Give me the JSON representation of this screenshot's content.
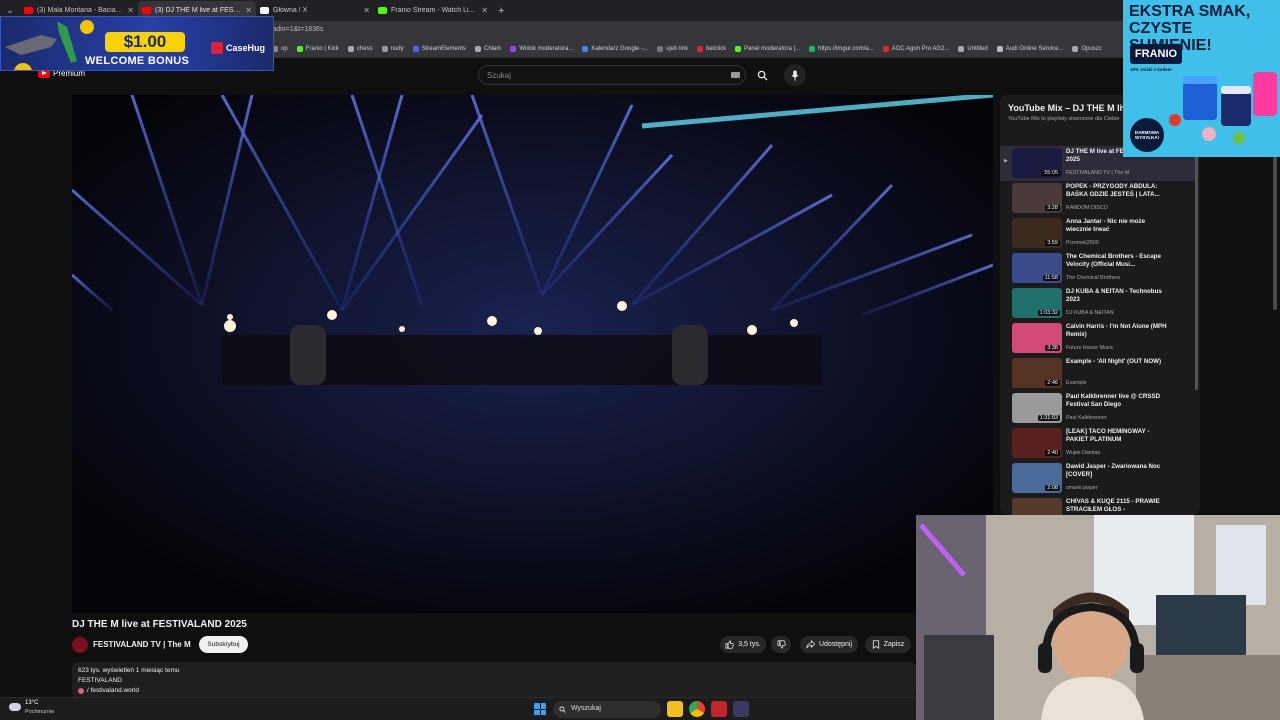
{
  "browser": {
    "tabs": [
      {
        "title": "(3) Mala Montana - Baciata [O",
        "favicon_color": "#ff0000",
        "active": false
      },
      {
        "title": "(3) DJ THE M live at FESTIVA",
        "favicon_color": "#ff0000",
        "active": true
      },
      {
        "title": "Główna / X",
        "favicon_color": "#ffffff",
        "active": false
      },
      {
        "title": "Franio Stream - Watch Live on",
        "favicon_color": "#53fc18",
        "active": false
      }
    ],
    "url_visible": "art_radio=1&t=1836s",
    "bookmarks": [
      {
        "label": "op",
        "color": "#888888"
      },
      {
        "label": "Franio | Kick",
        "color": "#53fc18"
      },
      {
        "label": "chess",
        "color": "#aaaaaa"
      },
      {
        "label": "nudy",
        "color": "#999999"
      },
      {
        "label": "StreamElements",
        "color": "#5b5bff"
      },
      {
        "label": "Chłam",
        "color": "#aaaaaa"
      },
      {
        "label": "Widok moderatora...",
        "color": "#9146ff"
      },
      {
        "label": "Kalendarz Google -...",
        "color": "#4285f4"
      },
      {
        "label": "ujeb link",
        "color": "#777777"
      },
      {
        "label": "betclick",
        "color": "#e2242a"
      },
      {
        "label": "Panel moderatora |...",
        "color": "#53fc18"
      },
      {
        "label": "https://imgur.com/a...",
        "color": "#1bb76e"
      },
      {
        "label": "AOC Agon Pro AG2...",
        "color": "#e2242a"
      },
      {
        "label": "Untitled",
        "color": "#aaaaaa"
      },
      {
        "label": "Audi Online Service...",
        "color": "#bbbbbb"
      },
      {
        "label": "Opuszc",
        "color": "#aaaaaa"
      }
    ]
  },
  "youtube": {
    "logo_suffix": "Premium",
    "search_placeholder": "Szukaj",
    "video": {
      "title": "DJ THE M live at FESTIVALAND 2025",
      "channel": "FESTIVALAND TV | The M",
      "subscribe_label": "Subskrybuj",
      "likes": "3,5 tys.",
      "share_label": "Udostępnij",
      "save_label": "Zapisz",
      "views_date": "623 tys. wyświetleń  1 miesiąc temu",
      "desc_line": "FESTIVALAND",
      "desc_link": "/ festivaland.world"
    },
    "playlist": {
      "title": "YouTube Mix – DJ THE M live at FESTIVALAND 2025",
      "subtitle": "YouTube Mix to playlisty stworzone dla Ciebie",
      "items": [
        {
          "title": "DJ THE M live at FESTIVALAND 2025",
          "channel": "FESTIVALAND TV | The M",
          "duration": "55:05",
          "thumb": "#1a1a40",
          "active": true
        },
        {
          "title": "POPEK - PRZYGODY ABDULA: BAŚKA GDZIE JESTEŚ | LATA...",
          "channel": "RANDOM DISCO",
          "duration": "3:28",
          "thumb": "#4a3a3a",
          "active": false
        },
        {
          "title": "Anna Jantar - Nic nie może wiecznie trwać",
          "channel": "Przemek2500",
          "duration": "3:59",
          "thumb": "#3c2a20",
          "active": false
        },
        {
          "title": "The Chemical Brothers - Escape Velocity (Official Musi...",
          "channel": "The Chemical Brothers",
          "duration": "11:58",
          "thumb": "#3a4c8a",
          "active": false
        },
        {
          "title": "DJ KUBA & NEITAN - Technobus 2023",
          "channel": "DJ KUBA & NEITAN",
          "duration": "1:03:32",
          "thumb": "#1f6f6a",
          "active": false
        },
        {
          "title": "Calvin Harris - I'm Not Alone (MPH Remix)",
          "channel": "Future House Music",
          "duration": "3:38",
          "thumb": "#d24a7a",
          "active": false
        },
        {
          "title": "Example - 'All Night' (OUT NOW)",
          "channel": "Example",
          "duration": "2:46",
          "thumb": "#553322",
          "active": false
        },
        {
          "title": "Paul Kalkbrenner live @ CRSSD Festival San Diego",
          "channel": "Paul Kalkbrenner",
          "duration": "1:31:03",
          "thumb": "#9a9a9a",
          "active": false
        },
        {
          "title": "[LEAK] TACO HEMINGWAY - PAKIET PLATINUM",
          "channel": "Wujek Damian",
          "duration": "2:40",
          "thumb": "#5a2020",
          "active": false
        },
        {
          "title": "Dawid Jasper - Zwariowana Noc [COVER]",
          "channel": "smarki jasper",
          "duration": "2:08",
          "thumb": "#4a6a9a",
          "active": false
        },
        {
          "title": "CHIVAS & KUQE 2115 - PRAWIE STRACIŁEM GŁOS -",
          "channel": "",
          "duration": "",
          "thumb": "#553a2a",
          "active": false
        }
      ]
    }
  },
  "ads": {
    "casehug": {
      "price": "$1.00",
      "bonus": "WELCOME BONUS",
      "brand": "CaseHug"
    },
    "franio": {
      "headline": "EKSTRA SMAK, CZYSTE SUMIENIE!",
      "brand": "FRANIO",
      "small": "10% zniżki z kodem",
      "badge": "DARMOWA WYSYŁKA!"
    }
  },
  "taskbar": {
    "weather_temp": "13°C",
    "weather_desc": "Pochmurnie",
    "search_placeholder": "Wyszukaj"
  }
}
